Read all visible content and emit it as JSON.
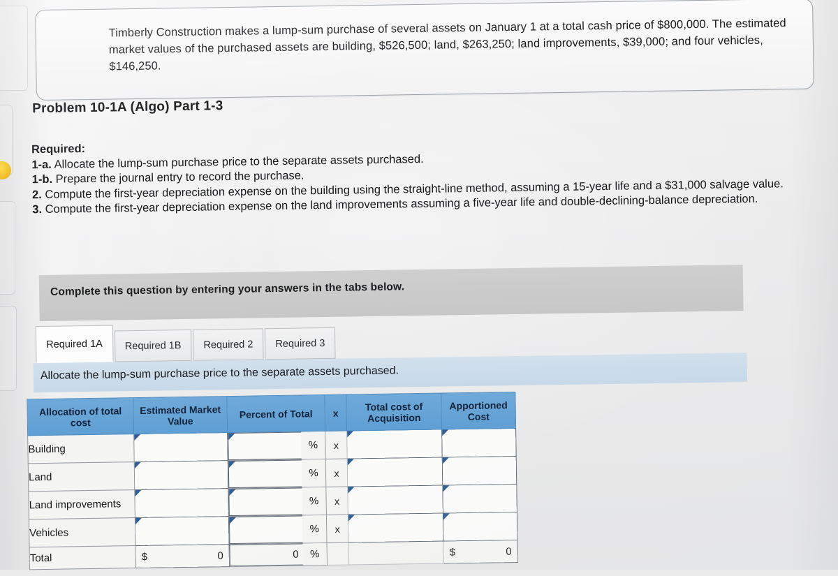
{
  "intro": {
    "text": "Timberly Construction makes a lump-sum purchase of several assets on January 1 at a total cash price of $800,000. The estimated market values of the purchased assets are building, $526,500; land, $263,250; land improvements, $39,000; and four vehicles, $146,250."
  },
  "problem": {
    "title": "Problem 10-1A (Algo) Part 1-3"
  },
  "required": {
    "heading": "Required:",
    "items": [
      {
        "label": "1-a.",
        "text": "Allocate the lump-sum purchase price to the separate assets purchased."
      },
      {
        "label": "1-b.",
        "text": "Prepare the journal entry to record the purchase."
      },
      {
        "label": "2.",
        "text": "Compute the first-year depreciation expense on the building using the straight-line method, assuming a 15-year life and a $31,000 salvage value."
      },
      {
        "label": "3.",
        "text": "Compute the first-year depreciation expense on the land improvements assuming a five-year life and double-declining-balance depreciation."
      }
    ]
  },
  "complete_bar": {
    "text": "Complete this question by entering your answers in the tabs below."
  },
  "tabs": [
    {
      "label": "Required 1A",
      "active": true
    },
    {
      "label": "Required 1B",
      "active": false
    },
    {
      "label": "Required 2",
      "active": false
    },
    {
      "label": "Required 3",
      "active": false
    }
  ],
  "task_band": {
    "text": "Allocate the lump-sum purchase price to the separate assets purchased."
  },
  "table": {
    "headers": {
      "allocation": "Allocation of total cost",
      "market_value": "Estimated Market Value",
      "percent": "Percent of Total",
      "times": "x",
      "total_cost": "Total cost of Acquisition",
      "apportioned": "Apportioned Cost"
    },
    "rows": [
      {
        "label": "Building",
        "market_value": "",
        "percent": "",
        "percent_sign": "%",
        "times": "x",
        "total_cost": "",
        "apportioned": ""
      },
      {
        "label": "Land",
        "market_value": "",
        "percent": "",
        "percent_sign": "%",
        "times": "x",
        "total_cost": "",
        "apportioned": ""
      },
      {
        "label": "Land improvements",
        "market_value": "",
        "percent": "",
        "percent_sign": "%",
        "times": "x",
        "total_cost": "",
        "apportioned": ""
      },
      {
        "label": "Vehicles",
        "market_value": "",
        "percent": "",
        "percent_sign": "%",
        "times": "x",
        "total_cost": "",
        "apportioned": ""
      }
    ],
    "total_row": {
      "label": "Total",
      "market_currency": "$",
      "market_value": "0",
      "percent": "0",
      "percent_sign": "%",
      "times": "",
      "total_cost": "",
      "apportioned_currency": "$",
      "apportioned": "0"
    }
  },
  "colors": {
    "header_blue": "#6fa9d9",
    "task_band_blue": "#c7d9e9",
    "complete_bar_gray": "#c7c7c7",
    "cell_marker_navy": "#2f5f96"
  }
}
